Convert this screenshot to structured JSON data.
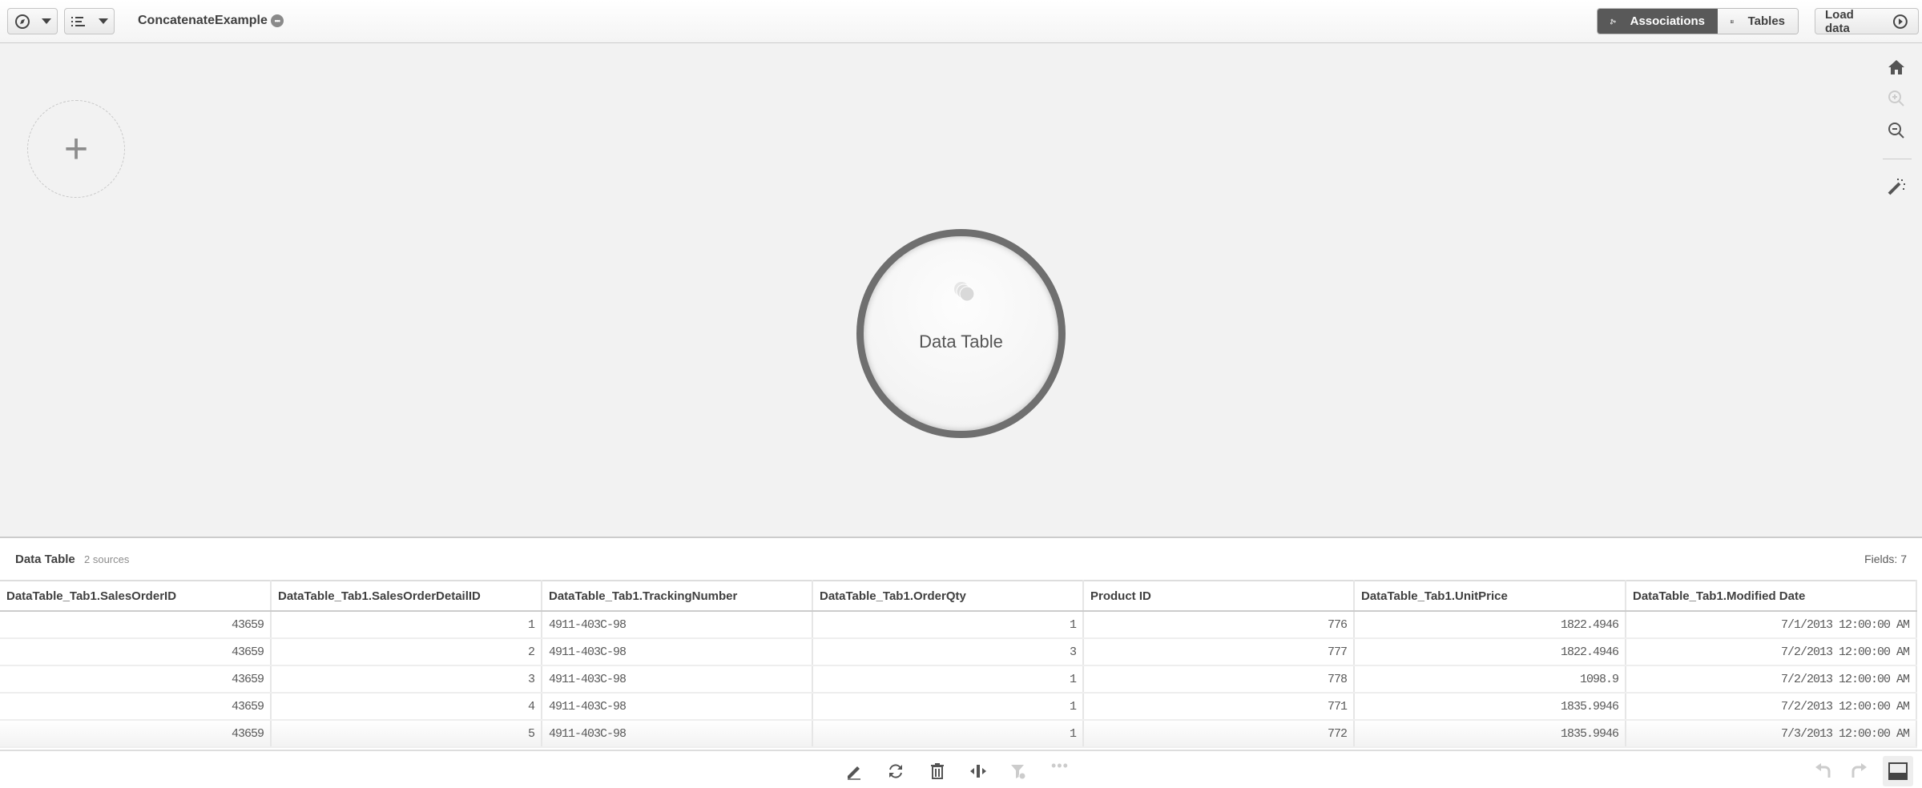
{
  "topbar": {
    "app_title": "ConcatenateExample",
    "associations_label": "Associations",
    "tables_label": "Tables",
    "load_data_label": "Load data"
  },
  "canvas": {
    "add_label": "+",
    "node_label": "Data Table"
  },
  "panel": {
    "title": "Data Table",
    "sources": "2 sources",
    "fields": "Fields: 7",
    "columns": [
      "DataTable_Tab1.SalesOrderID",
      "DataTable_Tab1.SalesOrderDetailID",
      "DataTable_Tab1.TrackingNumber",
      "DataTable_Tab1.OrderQty",
      "Product ID",
      "DataTable_Tab1.UnitPrice",
      "DataTable_Tab1.Modified Date"
    ],
    "rows": [
      [
        "43659",
        "1",
        "4911-403C-98",
        "1",
        "776",
        "1822.4946",
        "7/1/2013 12:00:00 AM"
      ],
      [
        "43659",
        "2",
        "4911-403C-98",
        "3",
        "777",
        "1822.4946",
        "7/2/2013 12:00:00 AM"
      ],
      [
        "43659",
        "3",
        "4911-403C-98",
        "1",
        "778",
        "1098.9",
        "7/2/2013 12:00:00 AM"
      ],
      [
        "43659",
        "4",
        "4911-403C-98",
        "1",
        "771",
        "1835.9946",
        "7/2/2013 12:00:00 AM"
      ],
      [
        "43659",
        "5",
        "4911-403C-98",
        "1",
        "772",
        "1835.9946",
        "7/3/2013 12:00:00 AM"
      ]
    ]
  },
  "colors": {
    "active_segment": "#595959",
    "node_ring": "#6f6f6f"
  }
}
